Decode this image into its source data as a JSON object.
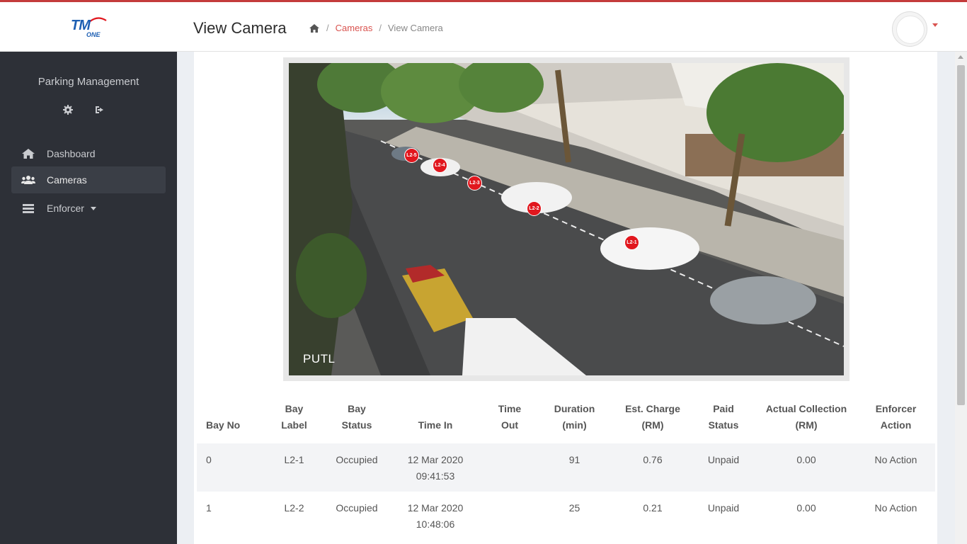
{
  "header": {
    "logo_text": "TM",
    "logo_subtext": "ONE",
    "page_title": "View Camera",
    "breadcrumb": {
      "home_icon": "home-icon",
      "items": [
        "Cameras",
        "View Camera"
      ]
    },
    "avatar_icon": "user-avatar-icon"
  },
  "sidebar": {
    "title": "Parking Management",
    "icons": [
      "gear-icon",
      "sign-out-icon"
    ],
    "nav": [
      {
        "label": "Dashboard",
        "icon": "home-icon"
      },
      {
        "label": "Cameras",
        "icon": "users-icon",
        "active": true
      },
      {
        "label": "Enforcer",
        "icon": "list-icon",
        "has_dropdown": true
      }
    ]
  },
  "camera": {
    "label": "PUTL",
    "bays": [
      "L2-5",
      "L2-4",
      "L2-3",
      "L2-2",
      "L2-1"
    ]
  },
  "table": {
    "headers": [
      [
        "Bay No"
      ],
      [
        "Bay",
        "Label"
      ],
      [
        "Bay",
        "Status"
      ],
      [
        "Time In"
      ],
      [
        "Time",
        "Out"
      ],
      [
        "Duration",
        "(min)"
      ],
      [
        "Est. Charge",
        "(RM)"
      ],
      [
        "Paid",
        "Status"
      ],
      [
        "Actual Collection",
        "(RM)"
      ],
      [
        "Enforcer",
        "Action"
      ]
    ],
    "rows": [
      {
        "bay_no": "0",
        "bay_label": "L2-1",
        "bay_status": "Occupied",
        "time_in_date": "12 Mar 2020",
        "time_in_time": "09:41:53",
        "time_out": "",
        "duration": "91",
        "est_charge": "0.76",
        "paid_status": "Unpaid",
        "actual_collection": "0.00",
        "enforcer_action": "No Action"
      },
      {
        "bay_no": "1",
        "bay_label": "L2-2",
        "bay_status": "Occupied",
        "time_in_date": "12 Mar 2020",
        "time_in_time": "10:48:06",
        "time_out": "",
        "duration": "25",
        "est_charge": "0.21",
        "paid_status": "Unpaid",
        "actual_collection": "0.00",
        "enforcer_action": "No Action"
      }
    ]
  },
  "colors": {
    "accent": "#d9534f",
    "sidebar_bg": "#2d3037",
    "marker": "#e1171e"
  }
}
